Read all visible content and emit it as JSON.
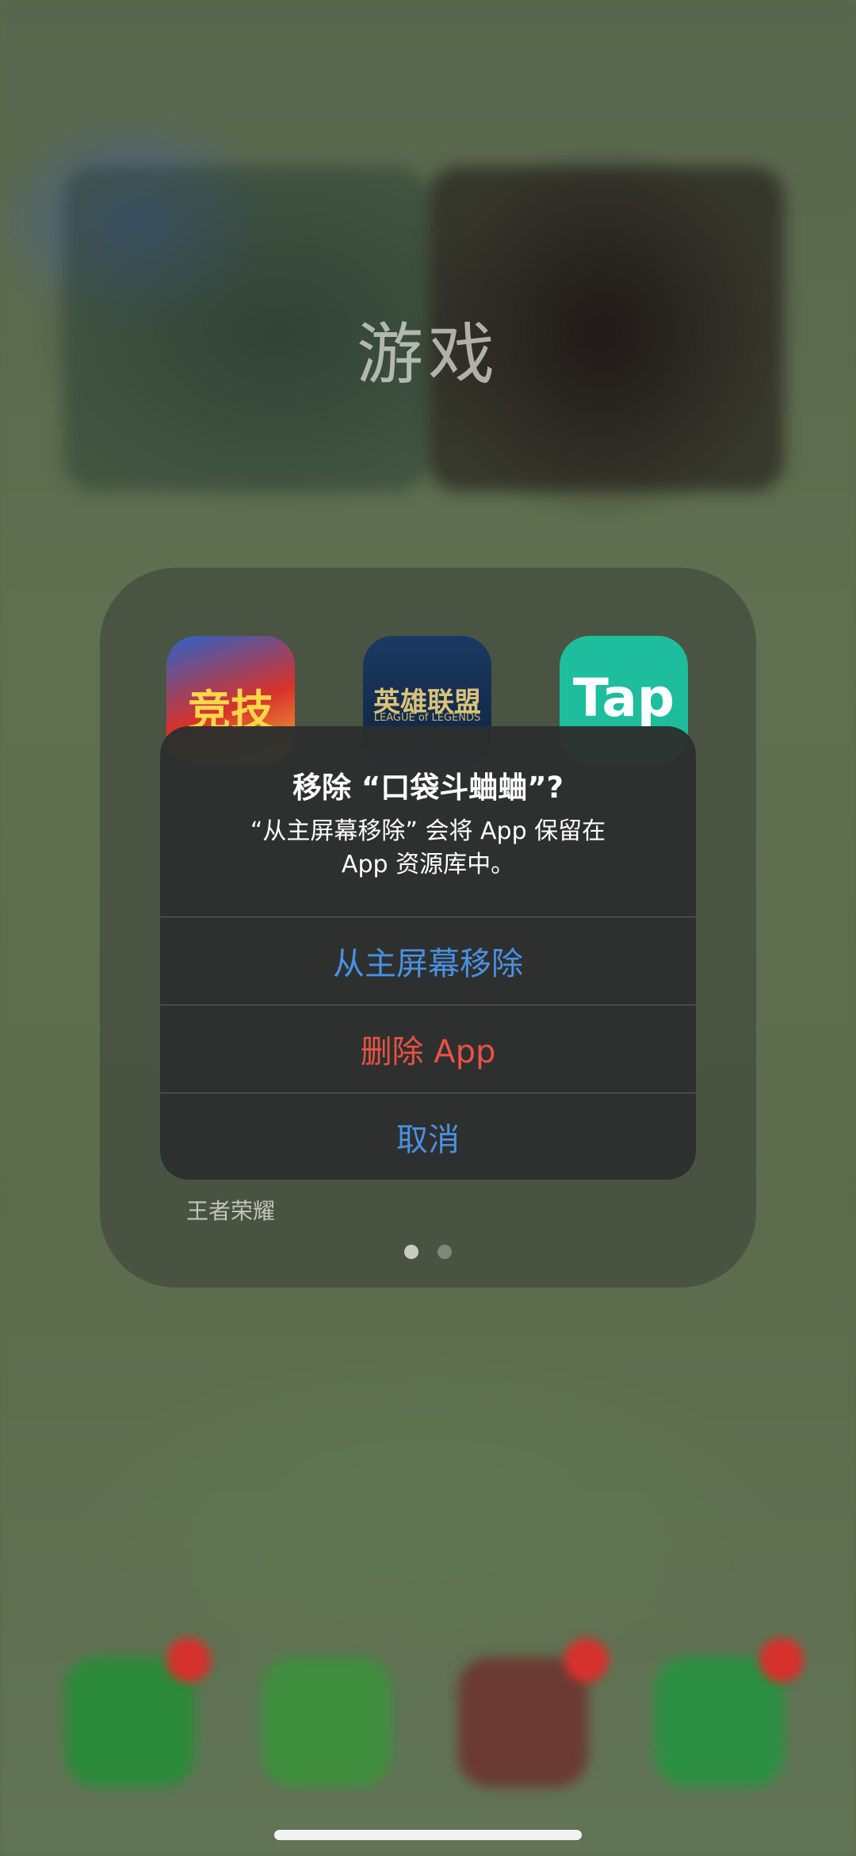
{
  "folder": {
    "title": "游戏",
    "apps": [
      {
        "icon": "trophy-game-icon",
        "glyph": "竞技"
      },
      {
        "icon": "league-of-legends-icon",
        "glyph": "英雄联盟",
        "subtext": "LEAGUE of LEGENDS"
      },
      {
        "icon": "taptap-icon",
        "glyph": "Tap"
      }
    ],
    "visible_app_label": "王者荣耀",
    "pages": 2,
    "current_page": 1
  },
  "alert": {
    "title": "移除 “口袋斗蛐蛐”?",
    "message_line1": "“从主屏幕移除” 会将 App 保留在",
    "message_line2": "App 资源库中。",
    "buttons": {
      "remove_from_home": "从主屏幕移除",
      "delete_app": "删除 App",
      "cancel": "取消"
    }
  },
  "colors": {
    "action_blue": "#4a90e2",
    "destructive_red": "#e85245",
    "alert_background": "#2c2f2e"
  },
  "dock": {
    "icons": [
      "phone-icon",
      "messages-icon",
      "game-icon",
      "wechat-icon"
    ]
  }
}
